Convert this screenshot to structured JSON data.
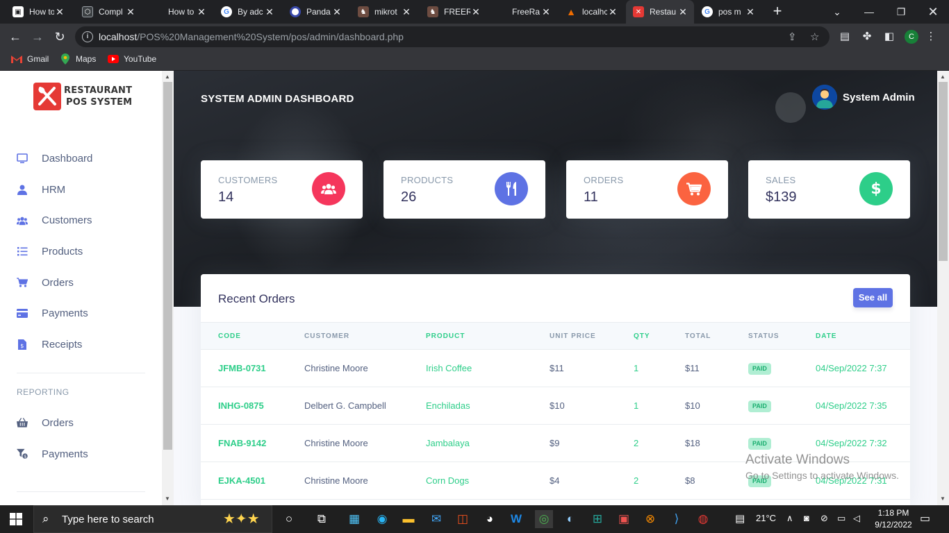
{
  "browser": {
    "tabs": [
      {
        "label": "How to",
        "favicon_color": "#ffffff"
      },
      {
        "label": "Compl",
        "favicon_color": "#3c4043"
      },
      {
        "label": "How to",
        "favicon_color": "#202124"
      },
      {
        "label": "By adc",
        "favicon_color": "#4285f4"
      },
      {
        "label": "Panda",
        "favicon_color": "#5c6bc0"
      },
      {
        "label": "mikrot",
        "favicon_color": "#8d6e63"
      },
      {
        "label": "FREER",
        "favicon_color": "#8d6e63"
      },
      {
        "label": "FreeRa",
        "favicon_color": "#202124"
      },
      {
        "label": "localhc",
        "favicon_color": "#e65100"
      },
      {
        "label": "Restau",
        "favicon_color": "#e53935",
        "active": true
      },
      {
        "label": "pos m",
        "favicon_color": "#4285f4"
      }
    ],
    "url_host": "localhost",
    "url_path": "/POS%20Management%20System/pos/admin/dashboard.php",
    "profile_initial": "C",
    "bookmarks": [
      "Gmail",
      "Maps",
      "YouTube"
    ]
  },
  "sidebar": {
    "logo_line1": "RESTAURANT",
    "logo_line2": "POS SYSTEM",
    "items": [
      {
        "label": "Dashboard",
        "icon": "monitor-icon"
      },
      {
        "label": "HRM",
        "icon": "user-icon"
      },
      {
        "label": "Customers",
        "icon": "users-icon"
      },
      {
        "label": "Products",
        "icon": "list-icon"
      },
      {
        "label": "Orders",
        "icon": "cart-icon"
      },
      {
        "label": "Payments",
        "icon": "credit-card-icon"
      },
      {
        "label": "Receipts",
        "icon": "receipt-icon"
      }
    ],
    "reporting_heading": "REPORTING",
    "reporting_items": [
      {
        "label": "Orders",
        "icon": "basket-icon"
      },
      {
        "label": "Payments",
        "icon": "funnel-dollar-icon"
      }
    ]
  },
  "header": {
    "title": "SYSTEM ADMIN DASHBOARD",
    "user_name": "System Admin"
  },
  "stats": [
    {
      "label": "CUSTOMERS",
      "value": "14",
      "color": "#f5365c",
      "icon": "users-icon"
    },
    {
      "label": "PRODUCTS",
      "value": "26",
      "color": "#5e72e4",
      "icon": "utensils-icon"
    },
    {
      "label": "ORDERS",
      "value": "11",
      "color": "#fb6340",
      "icon": "cart-icon"
    },
    {
      "label": "SALES",
      "value": "$139",
      "color": "#2dce89",
      "icon": "dollar-icon"
    }
  ],
  "recent_orders": {
    "title": "Recent Orders",
    "see_all": "See all",
    "columns": [
      "CODE",
      "CUSTOMER",
      "PRODUCT",
      "UNIT PRICE",
      "QTY",
      "TOTAL",
      "STATUS",
      "DATE"
    ],
    "rows": [
      [
        "JFMB-0731",
        "Christine Moore",
        "Irish Coffee",
        "$11",
        "1",
        "$11",
        "PAID",
        "04/Sep/2022 7:37"
      ],
      [
        "INHG-0875",
        "Delbert G. Campbell",
        "Enchiladas",
        "$10",
        "1",
        "$10",
        "PAID",
        "04/Sep/2022 7:35"
      ],
      [
        "FNAB-9142",
        "Christine Moore",
        "Jambalaya",
        "$9",
        "2",
        "$18",
        "PAID",
        "04/Sep/2022 7:32"
      ],
      [
        "EJKA-4501",
        "Christine Moore",
        "Corn Dogs",
        "$4",
        "2",
        "$8",
        "PAID",
        "04/Sep/2022 7:31"
      ]
    ]
  },
  "watermark": {
    "line1": "Activate Windows",
    "line2": "Go to Settings to activate Windows."
  },
  "taskbar": {
    "search_placeholder": "Type here to search",
    "temperature": "21°C",
    "time": "1:18 PM",
    "date": "9/12/2022"
  }
}
